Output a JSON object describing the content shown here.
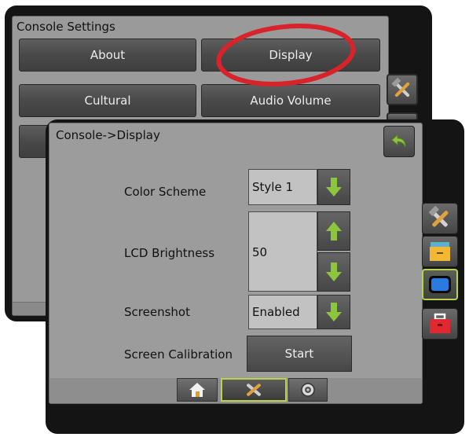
{
  "back_window": {
    "title": "Console Settings",
    "buttons": [
      "About",
      "Display",
      "Cultural",
      "Audio Volume"
    ]
  },
  "front_window": {
    "title": "Console->Display",
    "rows": {
      "color_scheme": {
        "label": "Color Scheme",
        "value": "Style 1"
      },
      "lcd_brightness": {
        "label": "LCD Brightness",
        "value": "50"
      },
      "screenshot": {
        "label": "Screenshot",
        "value": "Enabled"
      },
      "screen_calibration": {
        "label": "Screen Calibration",
        "button": "Start"
      }
    }
  },
  "side_icons": [
    "tools-icon",
    "system-drawer-icon",
    "console-display-icon",
    "toolbox-icon"
  ],
  "bottom_tabs": [
    "home-icon",
    "tools-icon",
    "gps-receiver-icon"
  ],
  "highlight": {
    "target": "Display",
    "color": "#d8232a"
  },
  "colors": {
    "accent_green": "#8cc63f",
    "selected_outline": "#b9d24a",
    "red": "#d8232a"
  }
}
